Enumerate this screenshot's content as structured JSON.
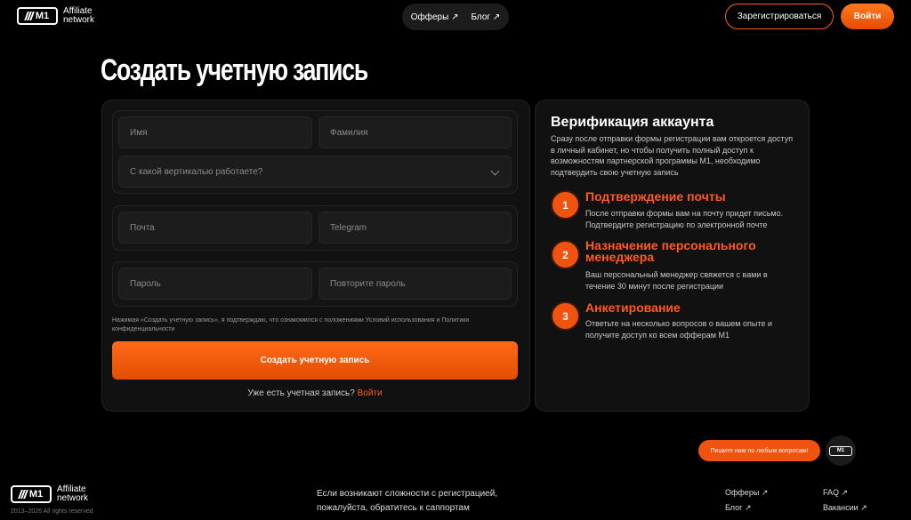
{
  "header": {
    "logo_text_line1": "Affiliate",
    "logo_text_line2": "network",
    "logo_badge": "M1",
    "nav": [
      {
        "label": "Офферы",
        "icon": "arrow-up-right-icon"
      },
      {
        "label": "Блог",
        "icon": "arrow-up-right-icon"
      }
    ],
    "register_label": "Зарегистрироваться",
    "login_label": "Войти"
  },
  "page_title": "Создать учетную запись",
  "form": {
    "first_name_placeholder": "Имя",
    "last_name_placeholder": "Фамилия",
    "vertical_placeholder": "С какой вертикалью работаете?",
    "email_placeholder": "Почта",
    "telegram_placeholder": "Telegram",
    "password_placeholder": "Пароль",
    "password_repeat_placeholder": "Повторите пароль",
    "consent_text": "Нажимая «Создать учетную запись», я подтверждаю, что ознакомился с положениями Условий использования и Политики конфиденциальности",
    "submit_label": "Создать учетную запись",
    "have_account_text": "Уже есть учетная запись?",
    "login_link": "Войти"
  },
  "verification": {
    "title": "Верификация аккаунта",
    "intro": "Сразу после отправки формы регистрации вам откроется доступ в личный кабинет, но чтобы получить полный доступ к возможностям партнерской программы М1, необходимо подтвердить свою учетную запись",
    "steps": [
      {
        "num": "1",
        "title": "Подтверждение почты",
        "desc": "После отправки формы вам на почту придет письмо. Подтвердите регистрацию по электронной почте"
      },
      {
        "num": "2",
        "title": "Назначение персонального менеджера",
        "desc": "Ваш персональный менеджер свяжется с вами в течение 30 минут после регистрации"
      },
      {
        "num": "3",
        "title": "Анкетирование",
        "desc": "Ответьте на несколько вопросов о вашем опыте и получите доступ ко всем офферам М1"
      }
    ]
  },
  "chat": {
    "button_label": "Пишите нам по любым вопросам!",
    "avatar_badge": "M1"
  },
  "footer": {
    "help_line1": "Если возникают сложности с регистрацией,",
    "help_line2": "пожалуйста, обратитесь к саппортам",
    "links_col1": [
      "Офферы",
      "Блог"
    ],
    "links_col2": [
      "FAQ",
      "Вакансии"
    ],
    "copyright": "2013–2026 All rights reserved",
    "colors": {
      "accent": "#ff5a1f",
      "background": "#000000",
      "card": "#111111"
    }
  }
}
